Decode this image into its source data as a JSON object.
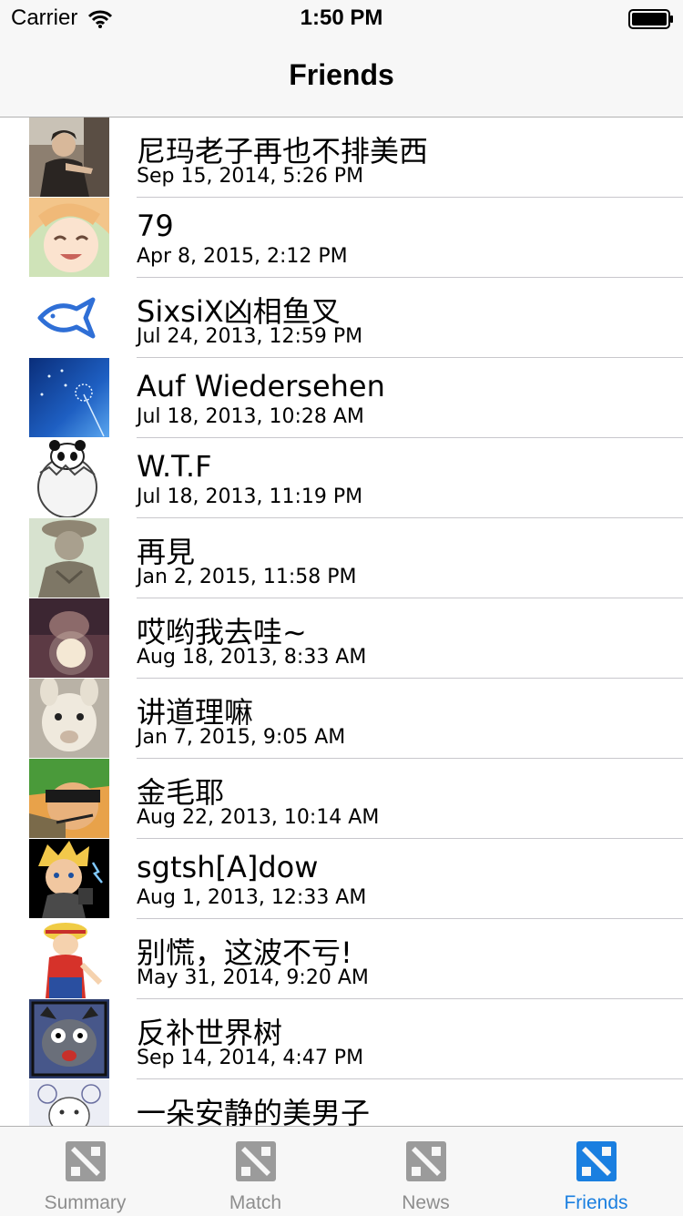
{
  "status_bar": {
    "carrier": "Carrier",
    "time": "1:50 PM"
  },
  "nav": {
    "title": "Friends"
  },
  "friends": [
    {
      "name": "尼玛老子再也不排美西",
      "date": "Sep 15, 2014, 5:26 PM"
    },
    {
      "name": "79",
      "date": "Apr 8, 2015, 2:12 PM"
    },
    {
      "name": "SixsiX凶相鱼叉",
      "date": "Jul 24, 2013, 12:59 PM"
    },
    {
      "name": "Auf Wiedersehen",
      "date": "Jul 18, 2013, 10:28 AM"
    },
    {
      "name": "W.T.F",
      "date": "Jul 18, 2013, 11:19 PM"
    },
    {
      "name": "再見",
      "date": "Jan 2, 2015, 11:58 PM"
    },
    {
      "name": "哎哟我去哇~",
      "date": "Aug 18, 2013, 8:33 AM"
    },
    {
      "name": "讲道理嘛",
      "date": "Jan 7, 2015, 9:05 AM"
    },
    {
      "name": "金毛耶",
      "date": "Aug 22, 2013, 10:14 AM"
    },
    {
      "name": "sgtsh[A]dow",
      "date": "Aug 1, 2013, 12:33 AM"
    },
    {
      "name": "别慌，这波不亏!",
      "date": "May 31, 2014, 9:20 AM"
    },
    {
      "name": "反补世界树",
      "date": "Sep 14, 2014, 4:47 PM"
    },
    {
      "name": "一朵安静的美男子",
      "date": ""
    }
  ],
  "tabs": [
    {
      "label": "Summary",
      "icon": "dota-icon",
      "active": false
    },
    {
      "label": "Match",
      "icon": "dota-icon",
      "active": false
    },
    {
      "label": "News",
      "icon": "dota-icon",
      "active": false
    },
    {
      "label": "Friends",
      "icon": "dota-icon",
      "active": true
    }
  ],
  "colors": {
    "accent": "#1a7fe0",
    "inactive": "#8e8e8e",
    "separator": "#c8c7cc",
    "bar_background": "#f7f7f7"
  }
}
